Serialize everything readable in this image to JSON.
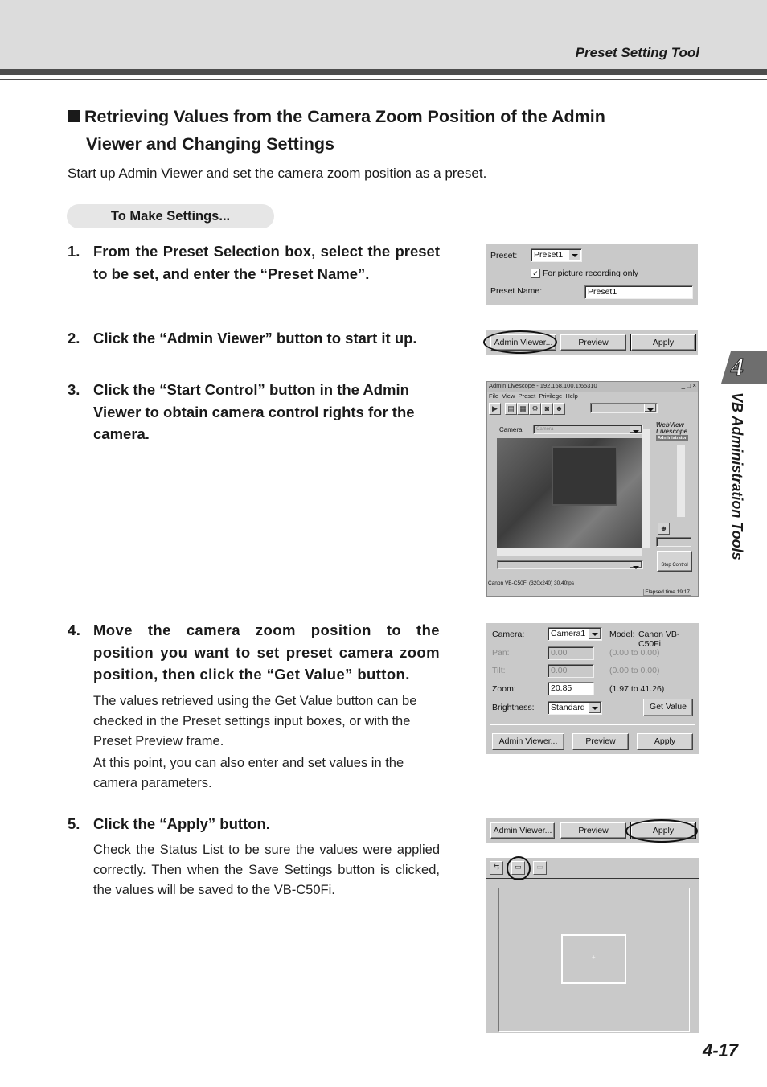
{
  "header": {
    "title": "Preset Setting Tool"
  },
  "section": {
    "title_line1": "Retrieving Values from the Camera Zoom Position of the Admin",
    "title_line2": "Viewer and Changing Settings",
    "intro": "Start up Admin Viewer and set the camera zoom position as a preset.",
    "pill": "To Make Settings..."
  },
  "steps": [
    {
      "num": "1.",
      "text": "From the Preset Selection box, select the preset to be set, and enter the “Preset Name”."
    },
    {
      "num": "2.",
      "text": "Click the “Admin Viewer” button to start it up."
    },
    {
      "num": "3.",
      "text": "Click the “Start Control” button in the Admin Viewer to obtain camera control rights for the camera."
    },
    {
      "num": "4.",
      "text": "Move the camera zoom position to the position you want to set preset camera zoom position, then click the “Get Value” button.",
      "body": [
        "The values retrieved using the Get Value button can be checked in the Preset settings input boxes, or with the Preset Preview frame.",
        "At this point, you can also enter and set values in the camera parameters."
      ]
    },
    {
      "num": "5.",
      "text": "Click the “Apply” button.",
      "body": [
        "Check the Status List to be sure the values were applied correctly. Then when the Save Settings button is clicked, the values will be saved to the VB-C50Fi."
      ]
    }
  ],
  "side_tab": {
    "chapter": "4",
    "label": "VB Administration Tools"
  },
  "page_number": "4-17",
  "shot1": {
    "preset_label": "Preset:",
    "preset_value": "Preset1",
    "checkbox_label": "For picture recording only",
    "checkbox_checked": true,
    "name_label": "Preset Name:",
    "name_value": "Preset1"
  },
  "buttons": {
    "admin_viewer": "Admin Viewer...",
    "preview": "Preview",
    "apply": "Apply"
  },
  "shot3": {
    "window_title": "Admin Livescope - 192.168.100.1:65310",
    "menu": [
      "File",
      "View",
      "Preset",
      "Privilege",
      "Help"
    ],
    "camera_label": "Camera:",
    "camera_value": "Camera",
    "brand_line1": "WebView",
    "brand_line2": "Livescope",
    "brand_badge": "Administrator",
    "stop_control": "Stop Control",
    "status_text": "Canon VB-C50Fi (320x240) 30.40fps",
    "elapsed": "Elapsed time 19:17"
  },
  "shot4": {
    "camera_label": "Camera:",
    "camera_value": "Camera1",
    "model_label": "Model:",
    "model_value": "Canon VB-C50Fi",
    "pan_label": "Pan:",
    "pan_value": "0.00",
    "pan_range": "(0.00 to 0.00)",
    "tilt_label": "Tilt:",
    "tilt_value": "0.00",
    "tilt_range": "(0.00 to 0.00)",
    "zoom_label": "Zoom:",
    "zoom_value": "20.85",
    "zoom_range": "(1.97 to 41.26)",
    "brightness_label": "Brightness:",
    "brightness_value": "Standard",
    "get_value": "Get Value"
  }
}
